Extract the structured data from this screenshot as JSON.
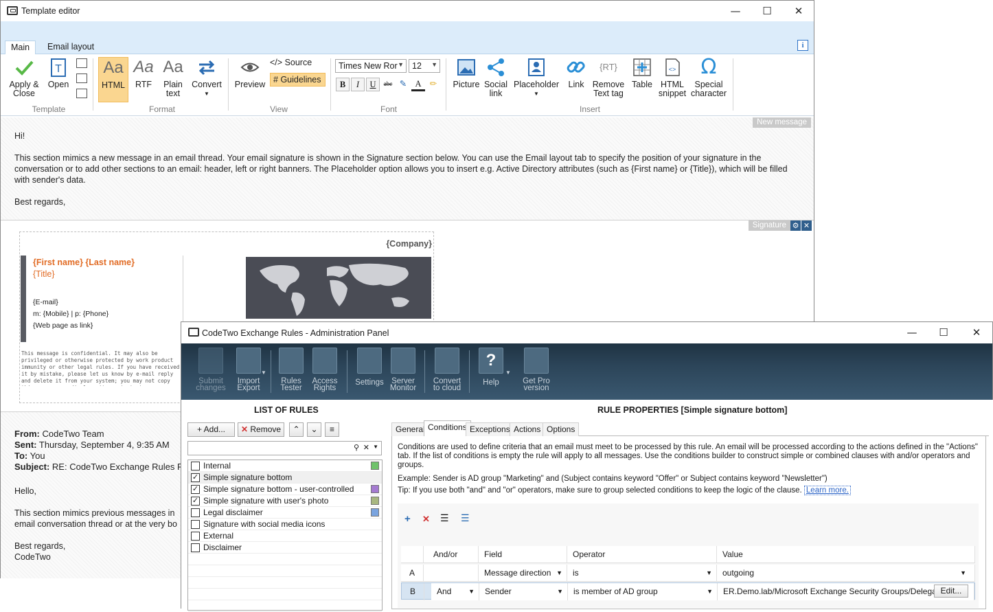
{
  "editor": {
    "title": "Template editor",
    "tabs": [
      "Main",
      "Email layout"
    ],
    "ribbon": {
      "apply_close": "Apply &\nClose",
      "open": "Open",
      "group_template": "Template",
      "html": "HTML",
      "rtf": "RTF",
      "plain": "Plain\ntext",
      "convert": "Convert",
      "group_format": "Format",
      "preview": "Preview",
      "source": "Source",
      "guidelines": "Guidelines",
      "group_view": "View",
      "font_name": "Times New Ror",
      "font_size": "12",
      "group_font": "Font",
      "picture": "Picture",
      "social": "Social\nlink",
      "placeholder": "Placeholder",
      "link": "Link",
      "remove_tag": "Remove\nText tag",
      "table": "Table",
      "html_snippet": "HTML\nsnippet",
      "special": "Special\ncharacter",
      "group_insert": "Insert"
    },
    "new_message_tag": "New message",
    "message": {
      "greeting": "Hi!",
      "body": "This section mimics a new message in an email thread. Your email signature is shown in the Signature section below. You can use the Email layout tab to specify the position of your signature in the conversation or to add other sections to an email: header, left or right banners. The Placeholder option allows you to insert e.g. Active Directory attributes (such as {First name} or {Title}), which will be filled with sender's data.",
      "closing": "Best regards,"
    },
    "signature_tag": "Signature",
    "signature": {
      "company": "{Company}",
      "name": "{First name} {Last name}",
      "title": "{Title}",
      "email": "{E-mail}",
      "phones": "m:  {Mobile} | p: {Phone}",
      "web": "{Web page as link}",
      "disclaimer": "This message is confidential. It may also be privileged or otherwise protected by work product immunity or other legal rules. If you have received it by mistake, please let us know by e-mail reply and delete it from your system; you may not copy this message or disclose its contents to anyone. Please send us by fax any message containing deadlines as incoming e-mails are not screened for response deadlines. The integrity and security of this message cannot be guaranteed on the Internet."
    },
    "prev": {
      "from_label": "From:",
      "from": "CodeTwo Team",
      "sent_label": "Sent:",
      "sent": "Thursday, September 4, 9:35 AM",
      "to_label": "To:",
      "to": "You",
      "subject_label": "Subject:",
      "subject": "RE: CodeTwo Exchange Rules P",
      "hello": "Hello,",
      "body1": "This section mimics previous messages in",
      "body2": "email conversation thread or at the very bo",
      "closing": "Best regards,",
      "sign": "CodeTwo"
    }
  },
  "admin": {
    "title": "CodeTwo Exchange Rules - Administration Panel",
    "toolbar": {
      "submit": "Submit\nchanges",
      "import": "Import\nExport",
      "rules_tester": "Rules\nTester",
      "access": "Access\nRights",
      "settings": "Settings",
      "server": "Server\nMonitor",
      "convert": "Convert\nto cloud",
      "help": "Help",
      "getpro": "Get Pro\nversion"
    },
    "list_header": "LIST OF RULES",
    "add": "Add...",
    "remove": "Remove",
    "rules": [
      {
        "name": "Internal",
        "checked": false,
        "color": "#6fc26b"
      },
      {
        "name": "Simple signature bottom",
        "checked": true,
        "color": "",
        "selected": true
      },
      {
        "name": "Simple signature bottom - user-controlled",
        "checked": true,
        "color": "#a57bd1"
      },
      {
        "name": "Simple signature with user's photo",
        "checked": true,
        "color": "#a8b780"
      },
      {
        "name": "Legal disclaimer",
        "checked": false,
        "color": "#7aa4df"
      },
      {
        "name": "Signature with social media icons",
        "checked": false,
        "color": ""
      },
      {
        "name": "External",
        "checked": false,
        "color": ""
      },
      {
        "name": "Disclaimer",
        "checked": false,
        "color": ""
      }
    ],
    "props_header": "RULE PROPERTIES [Simple signature bottom]",
    "prop_tabs": [
      "General",
      "Conditions",
      "Exceptions",
      "Actions",
      "Options"
    ],
    "conditions_desc": "Conditions are used to define criteria that an email must meet to be processed by this rule. An email will be processed according to the actions defined in the \"Actions\" tab. If the list of conditions is empty the rule will apply to all messages. Use the conditions builder to construct simple or combined clauses with and/or operators and groups.",
    "example": "Example: Sender is AD group \"Marketing\" and (Subject contains keyword \"Offer\" or Subject contains keyword \"Newsletter\")",
    "tip": "Tip: If you use both \"and\" and \"or\" operators, make sure to group selected conditions to keep the logic of the clause.",
    "learn_more": "Learn more.",
    "grid_headers": [
      "And/or",
      "Field",
      "Operator",
      "Value"
    ],
    "rows": [
      {
        "id": "A",
        "andor": "",
        "field": "Message direction",
        "operator": "is",
        "value": "outgoing"
      },
      {
        "id": "B",
        "andor": "And",
        "field": "Sender",
        "operator": "is member of AD group",
        "value": "ER.Demo.lab/Microsoft Exchange Security Groups/Delegat...",
        "edit": "Edit..."
      }
    ]
  }
}
